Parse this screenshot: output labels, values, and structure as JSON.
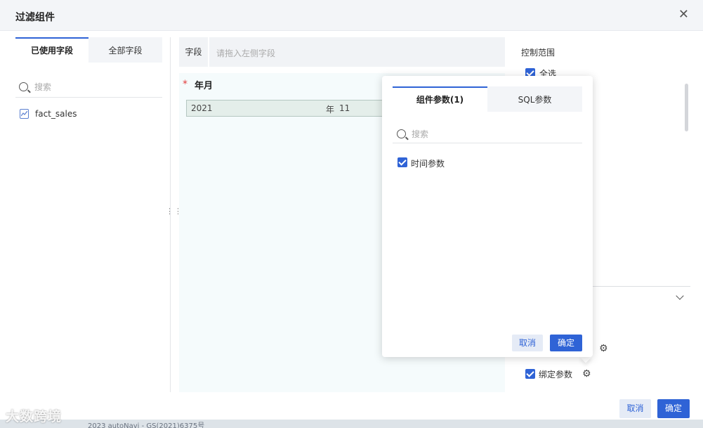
{
  "dialog": {
    "title": "过滤组件",
    "close_icon": "close-icon"
  },
  "left_panel": {
    "tabs": [
      {
        "label": "已使用字段",
        "active": true
      },
      {
        "label": "全部字段",
        "active": false
      }
    ],
    "search_placeholder": "搜索",
    "fields": [
      {
        "label": "fact_sales",
        "icon": "line-chart-icon"
      }
    ]
  },
  "middle": {
    "field_label": "字段",
    "field_placeholder": "请拖入左侧字段",
    "preview": {
      "required_mark": "*",
      "title": "年月",
      "year": "2021",
      "year_unit": "年",
      "month": "11"
    }
  },
  "right_panel": {
    "title": "控制范围",
    "select_all_label": "全选",
    "bind_params_label": "绑定参数"
  },
  "popover": {
    "tabs": [
      {
        "label": "组件参数(1)",
        "active": true
      },
      {
        "label": "SQL参数",
        "active": false
      }
    ],
    "search_placeholder": "搜索",
    "items": [
      {
        "label": "时间参数",
        "checked": true
      }
    ],
    "cancel_label": "取消",
    "confirm_label": "确定"
  },
  "footer": {
    "cancel_label": "取消",
    "confirm_label": "确定"
  },
  "background": {
    "text": "2023 autoNavi - GS(2021)6375号"
  },
  "watermark": {
    "text": "大数跨境"
  },
  "colors": {
    "accent": "#2f63d6",
    "required": "#e23d3d",
    "preview_bg": "#f5fbfc"
  }
}
